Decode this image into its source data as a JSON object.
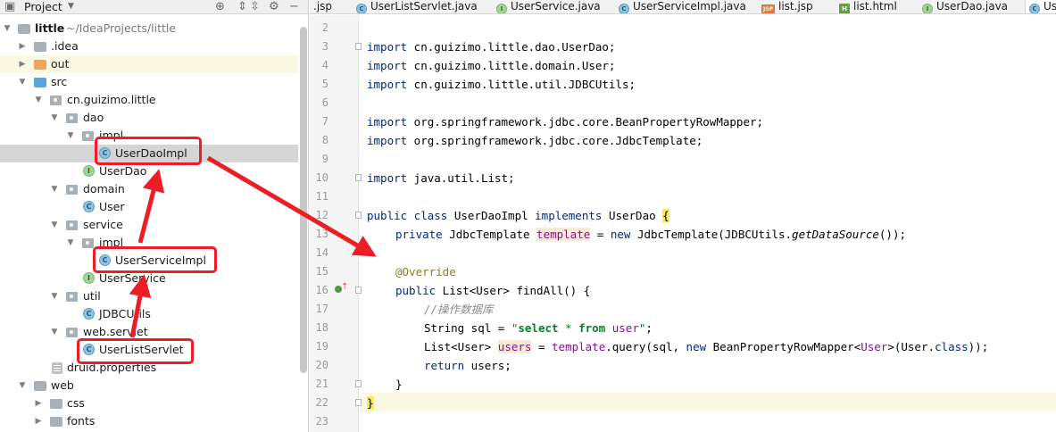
{
  "project_panel": {
    "title": "Project",
    "tree": [
      {
        "label": "little",
        "hint": "~/IdeaProjects/little",
        "icon": "module-folder-icon"
      },
      {
        "label": ".idea",
        "icon": "folder-icon"
      },
      {
        "label": "out",
        "icon": "excluded-folder-icon"
      },
      {
        "label": "src",
        "icon": "source-folder-icon"
      },
      {
        "label": "cn.guizimo.little",
        "icon": "package-icon"
      },
      {
        "label": "dao",
        "icon": "package-icon"
      },
      {
        "label": "impl",
        "icon": "package-icon"
      },
      {
        "label": "UserDaoImpl",
        "icon": "class-icon"
      },
      {
        "label": "UserDao",
        "icon": "interface-icon"
      },
      {
        "label": "domain",
        "icon": "package-icon"
      },
      {
        "label": "User",
        "icon": "class-icon"
      },
      {
        "label": "service",
        "icon": "package-icon"
      },
      {
        "label": "impl",
        "icon": "package-icon"
      },
      {
        "label": "UserServiceImpl",
        "icon": "class-icon"
      },
      {
        "label": "UserService",
        "icon": "interface-icon"
      },
      {
        "label": "util",
        "icon": "package-icon"
      },
      {
        "label": "JDBCUtils",
        "icon": "class-icon"
      },
      {
        "label": "web.servlet",
        "icon": "package-icon"
      },
      {
        "label": "UserListServlet",
        "icon": "class-icon"
      },
      {
        "label": "druid.properties",
        "icon": "properties-file-icon"
      },
      {
        "label": "web",
        "icon": "web-folder-icon"
      },
      {
        "label": "css",
        "icon": "folder-icon"
      },
      {
        "label": "fonts",
        "icon": "folder-icon"
      }
    ]
  },
  "tabs": [
    {
      "label": ".jsp",
      "icon": "none"
    },
    {
      "label": "UserListServlet.java",
      "icon": "class-icon"
    },
    {
      "label": "UserService.java",
      "icon": "interface-icon"
    },
    {
      "label": "UserServiceImpl.java",
      "icon": "class-icon"
    },
    {
      "label": "list.jsp",
      "icon": "jsp-file-icon"
    },
    {
      "label": "list.html",
      "icon": "html-file-icon"
    },
    {
      "label": "UserDao.java",
      "icon": "interface-icon"
    },
    {
      "label": "Us",
      "icon": "class-icon"
    }
  ],
  "editor": {
    "line_numbers": [
      "2",
      "3",
      "4",
      "5",
      "6",
      "7",
      "8",
      "9",
      "10",
      "11",
      "12",
      "13",
      "14",
      "15",
      "16",
      "17",
      "18",
      "19",
      "20",
      "21",
      "22",
      "23"
    ],
    "code": {
      "l3": [
        "import",
        " cn.guizimo.little.dao.UserDao;"
      ],
      "l4": [
        "import",
        " cn.guizimo.little.domain.User;"
      ],
      "l5": [
        "import",
        " cn.guizimo.little.util.JDBCUtils;"
      ],
      "l7": [
        "import",
        " org.springframework.jdbc.core.BeanPropertyRowMapper;"
      ],
      "l8": [
        "import",
        " org.springframework.jdbc.core.JdbcTemplate;"
      ],
      "l10": [
        "import",
        " java.util.List;"
      ],
      "l12": [
        "public class",
        " UserDaoImpl ",
        "implements",
        " UserDao ",
        "{"
      ],
      "l13": [
        "private",
        " JdbcTemplate ",
        "template",
        " = ",
        "new",
        " JdbcTemplate(JDBCUtils.",
        "getDataSource",
        "());"
      ],
      "l15": [
        "@Override"
      ],
      "l16": [
        "public",
        " List<User> findAll() {"
      ],
      "l17": [
        "//操作数据库"
      ],
      "l18": [
        "String sql = ",
        "\"",
        "select",
        " * ",
        "from",
        " ",
        "user",
        "\"",
        ";"
      ],
      "l19": [
        "List<User> ",
        "users",
        " = ",
        "template",
        ".query(sql, ",
        "new",
        " BeanPropertyRowMapper<",
        "User",
        ">(User.",
        "class",
        "));"
      ],
      "l20": [
        "return",
        " users;"
      ],
      "l21": [
        "}"
      ],
      "l22": [
        "}"
      ]
    }
  },
  "colors": {
    "annotation_red": "#ee1c24",
    "keyword": "#00297f",
    "field": "#871094",
    "string": "#087e2b",
    "comment": "#8c8c8c"
  }
}
